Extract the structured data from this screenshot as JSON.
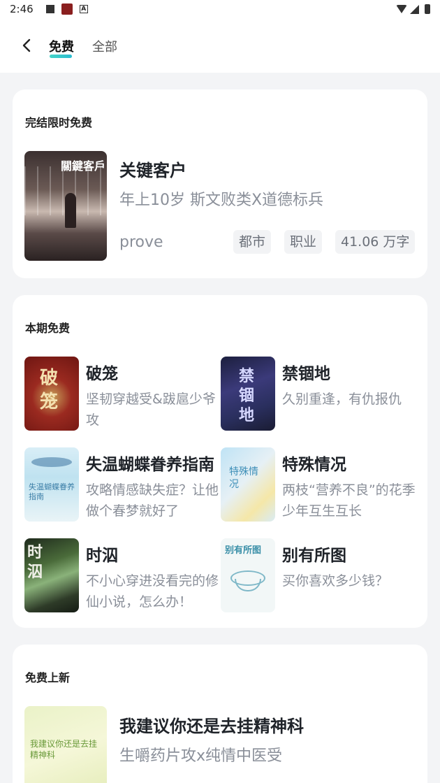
{
  "status_bar": {
    "time": "2:46"
  },
  "header": {
    "tabs": [
      {
        "label": "免费",
        "active": true
      },
      {
        "label": "全部",
        "active": false
      }
    ]
  },
  "sections": {
    "completed_free": {
      "title": "完结限时免费",
      "book": {
        "title": "关键客户",
        "description": "年上10岁 斯文败类X道德标兵",
        "author": "prove",
        "tags": [
          "都市",
          "职业",
          "41.06 万字"
        ],
        "cover_text": "關鍵客戶"
      }
    },
    "this_period_free": {
      "title": "本期免费",
      "books": [
        {
          "title": "破笼",
          "description": "坚韧穿越受&跋扈少爷攻",
          "cover_text": "破笼"
        },
        {
          "title": "禁锢地",
          "description": "久别重逢，有仇报仇",
          "cover_text": "禁锢地"
        },
        {
          "title": "失温蝴蝶眷养指南",
          "description": "攻略情感缺失症？让他做个春梦就好了",
          "cover_text": "失温蝴蝶眷养指南"
        },
        {
          "title": "特殊情况",
          "description": "两枝“营养不良”的花季少年互生互长",
          "cover_text": "特殊情况"
        },
        {
          "title": "时泅",
          "description": "不小心穿进没看完的修仙小说，怎么办！",
          "cover_text": "时泅"
        },
        {
          "title": "别有所图",
          "description": "买你喜欢多少钱？",
          "cover_text": "别有所图"
        }
      ]
    },
    "new_free": {
      "title": "免费上新",
      "book": {
        "title": "我建议你还是去挂精神科",
        "description": "生嚼药片攻x纯情中医受",
        "cover_text": "我建议你还是去挂精神科"
      }
    }
  },
  "colors": {
    "accent": "#2bbcd0",
    "background": "#f3f4f6",
    "card": "#ffffff",
    "muted_text": "#8a8f99"
  }
}
